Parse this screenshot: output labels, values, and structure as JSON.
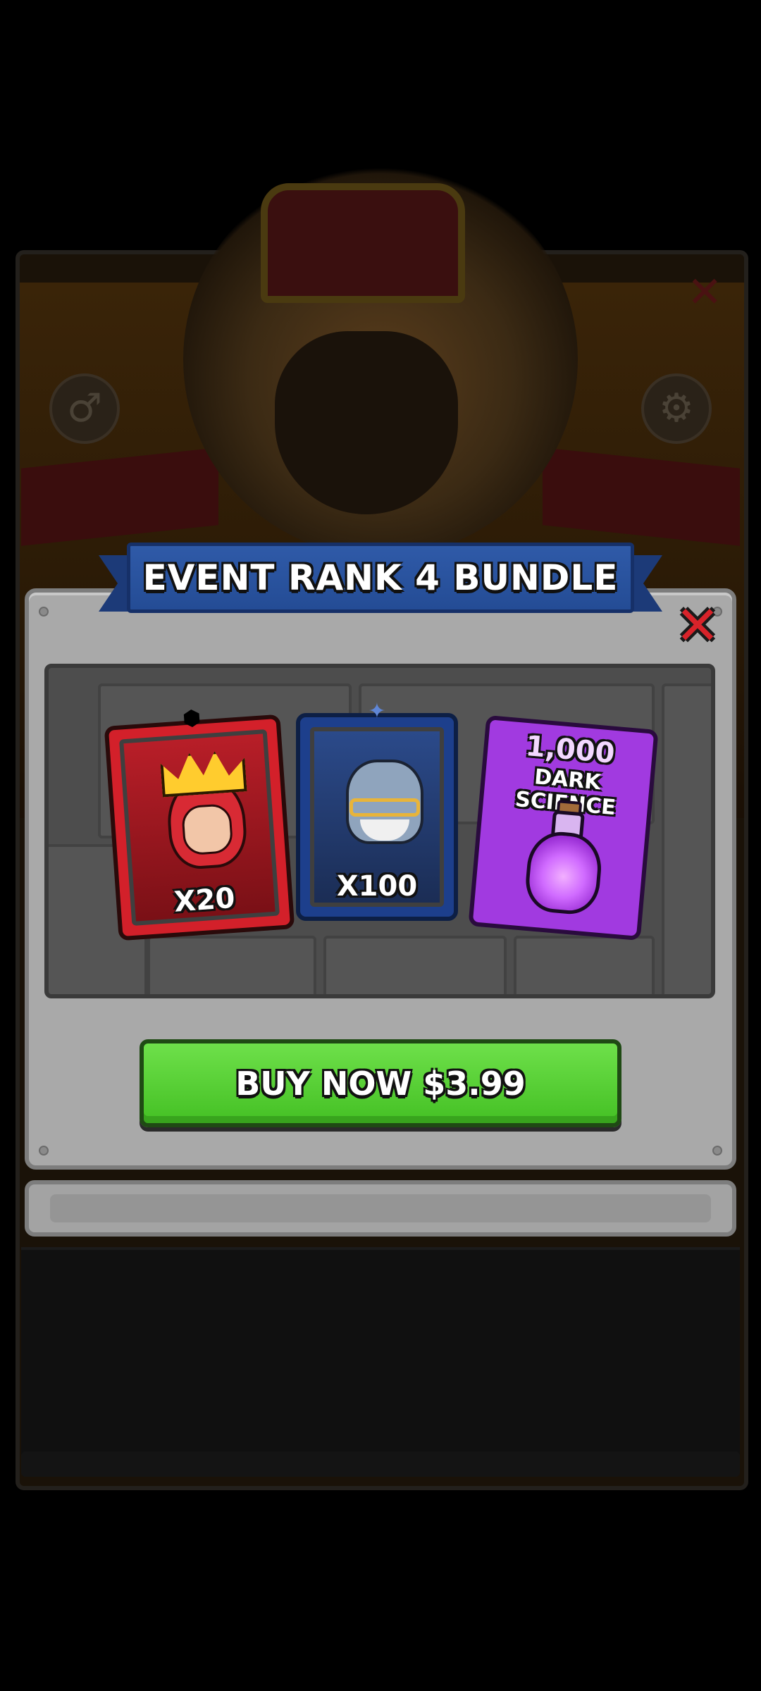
{
  "dialog": {
    "title": "EVENT RANK 4 BUNDLE",
    "close_icon": "close-x-icon",
    "items": [
      {
        "type": "hero-card",
        "color": "#d3202a",
        "quantity": "X20",
        "icon": "queen-hero-icon",
        "badge_icon": "red-rarity-badge-icon"
      },
      {
        "type": "hero-card",
        "color": "#1d3f8c",
        "quantity": "X100",
        "icon": "robot-hero-icon",
        "badge_icon": "blue-rarity-badge-icon"
      },
      {
        "type": "resource-card",
        "color": "#a13ae0",
        "amount": "1,000",
        "label_line1": "DARK",
        "label_line2": "SCIENCE",
        "icon": "dark-science-potion-icon"
      }
    ],
    "buy_button": {
      "label": "BUY NOW $3.99",
      "color": "#4cc82a"
    }
  },
  "background": {
    "gender_icon": "male-symbol-icon",
    "settings_icon": "gear-icon",
    "close_icon": "close-x-icon"
  }
}
